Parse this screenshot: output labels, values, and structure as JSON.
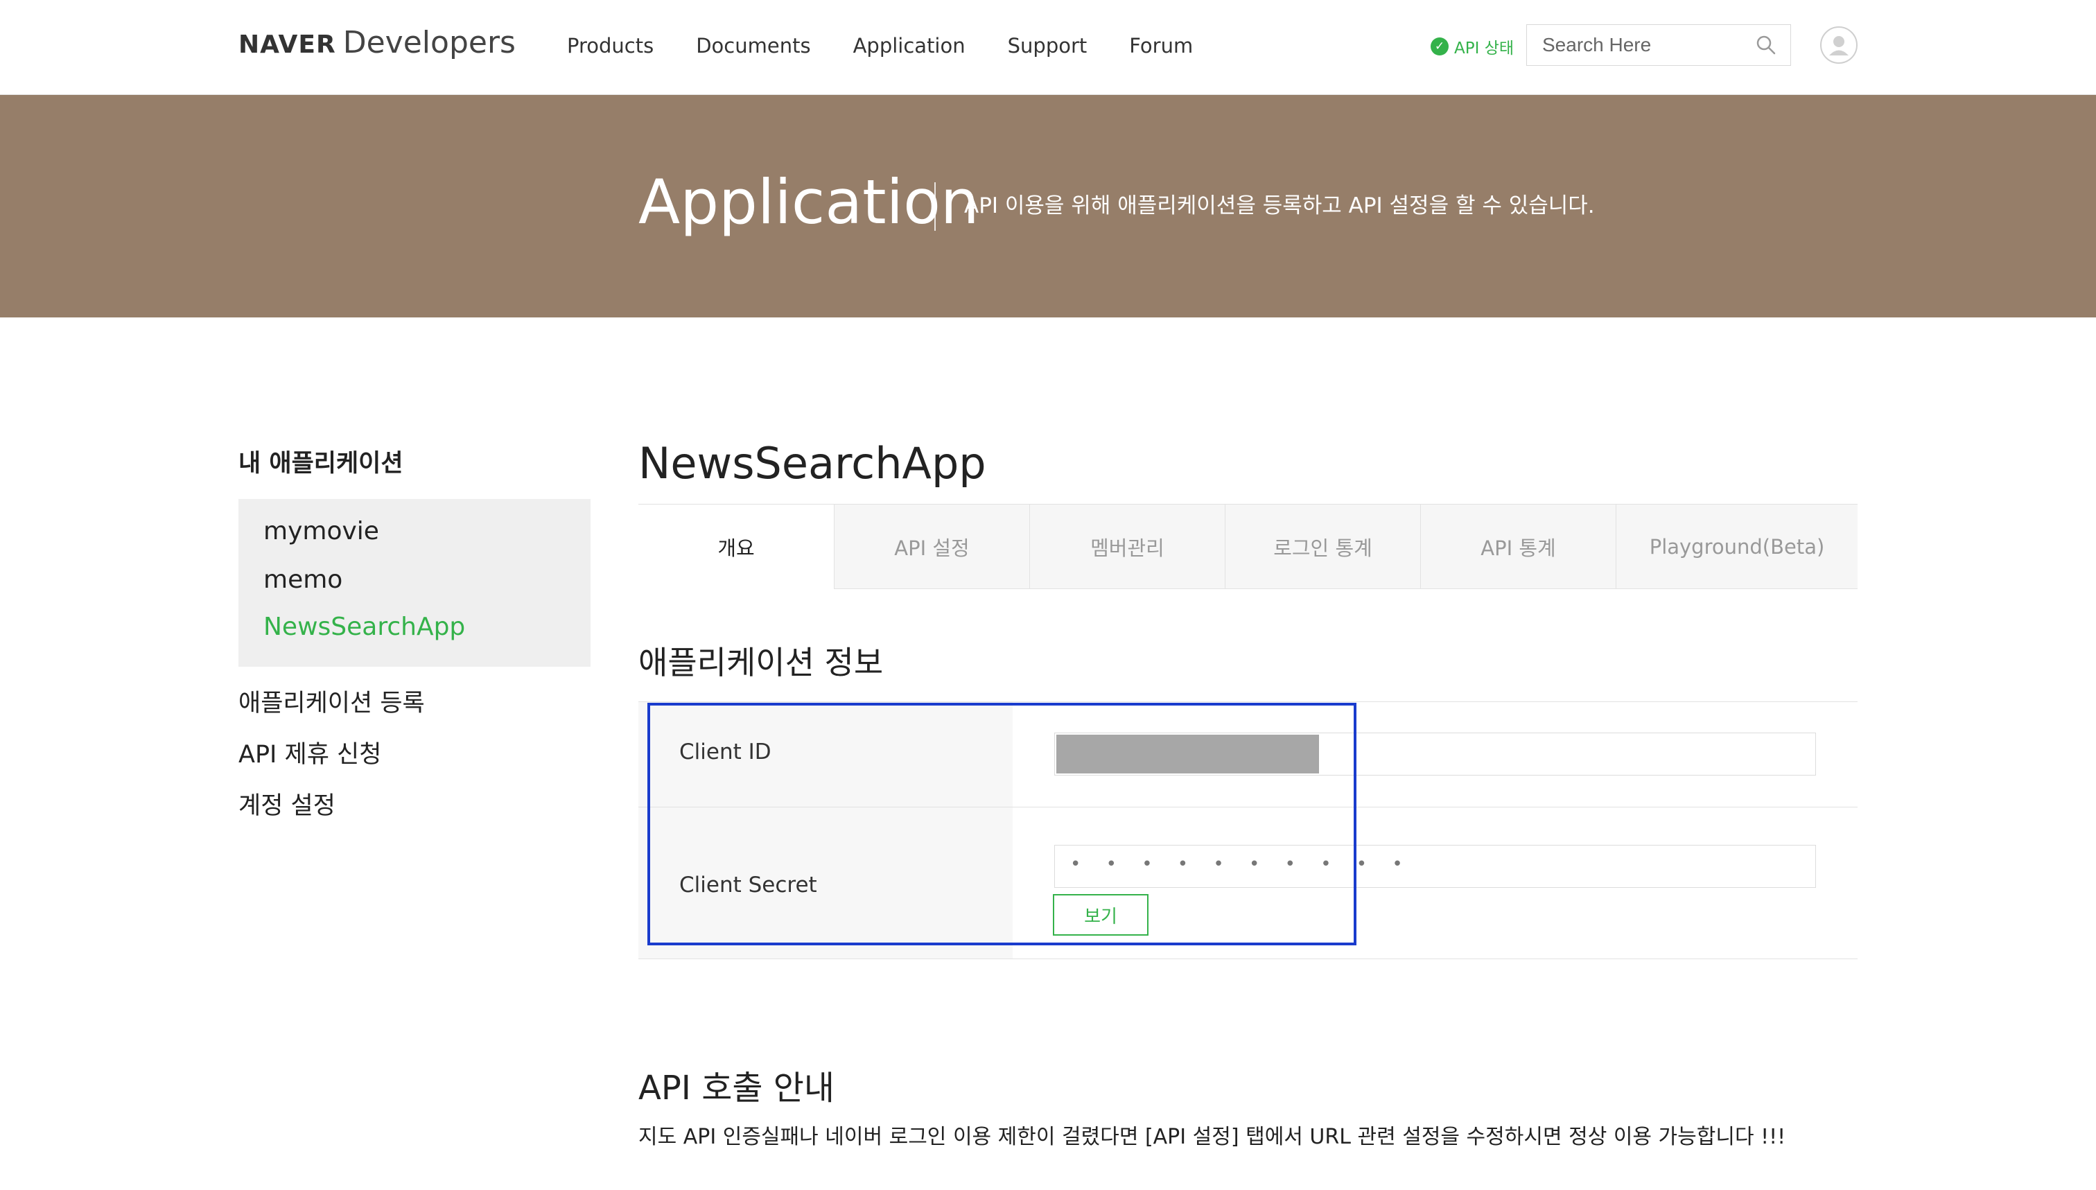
{
  "header": {
    "logo": {
      "brand": "NAVER",
      "suffix": "Developers"
    },
    "nav": [
      "Products",
      "Documents",
      "Application",
      "Support",
      "Forum"
    ],
    "api_status": "API 상태",
    "search_placeholder": "Search Here"
  },
  "hero": {
    "title": "Application",
    "description": "API 이용을 위해 애플리케이션을 등록하고 API 설정을 할 수 있습니다."
  },
  "sidebar": {
    "heading": "내 애플리케이션",
    "apps": [
      {
        "label": "mymovie",
        "active": false
      },
      {
        "label": "memo",
        "active": false
      },
      {
        "label": "NewsSearchApp",
        "active": true
      }
    ],
    "links": [
      "애플리케이션 등록",
      "API 제휴 신청",
      "계정 설정"
    ]
  },
  "main": {
    "app_title": "NewsSearchApp",
    "tabs": [
      {
        "label": "개요",
        "active": true
      },
      {
        "label": "API 설정",
        "active": false
      },
      {
        "label": "멤버관리",
        "active": false
      },
      {
        "label": "로그인 통계",
        "active": false
      },
      {
        "label": "API 통계",
        "active": false
      },
      {
        "label": "Playground(Beta)",
        "active": false
      }
    ],
    "section_title": "애플리케이션 정보",
    "client_id_label": "Client ID",
    "client_secret_label": "Client Secret",
    "client_secret_masked": "• • • • • • • • • •",
    "view_button": "보기",
    "api_call_title": "API 호출 안내",
    "api_call_desc": "지도 API 인증실패나 네이버 로그인 이용 제한이 걸렸다면 [API 설정] 탭에서 URL 관련 설정을 수정하시면 정상 이용 가능합니다 !!!"
  },
  "colors": {
    "hero_bg": "#967e69",
    "accent_green": "#34b24a",
    "highlight_blue": "#1a3ccd"
  }
}
